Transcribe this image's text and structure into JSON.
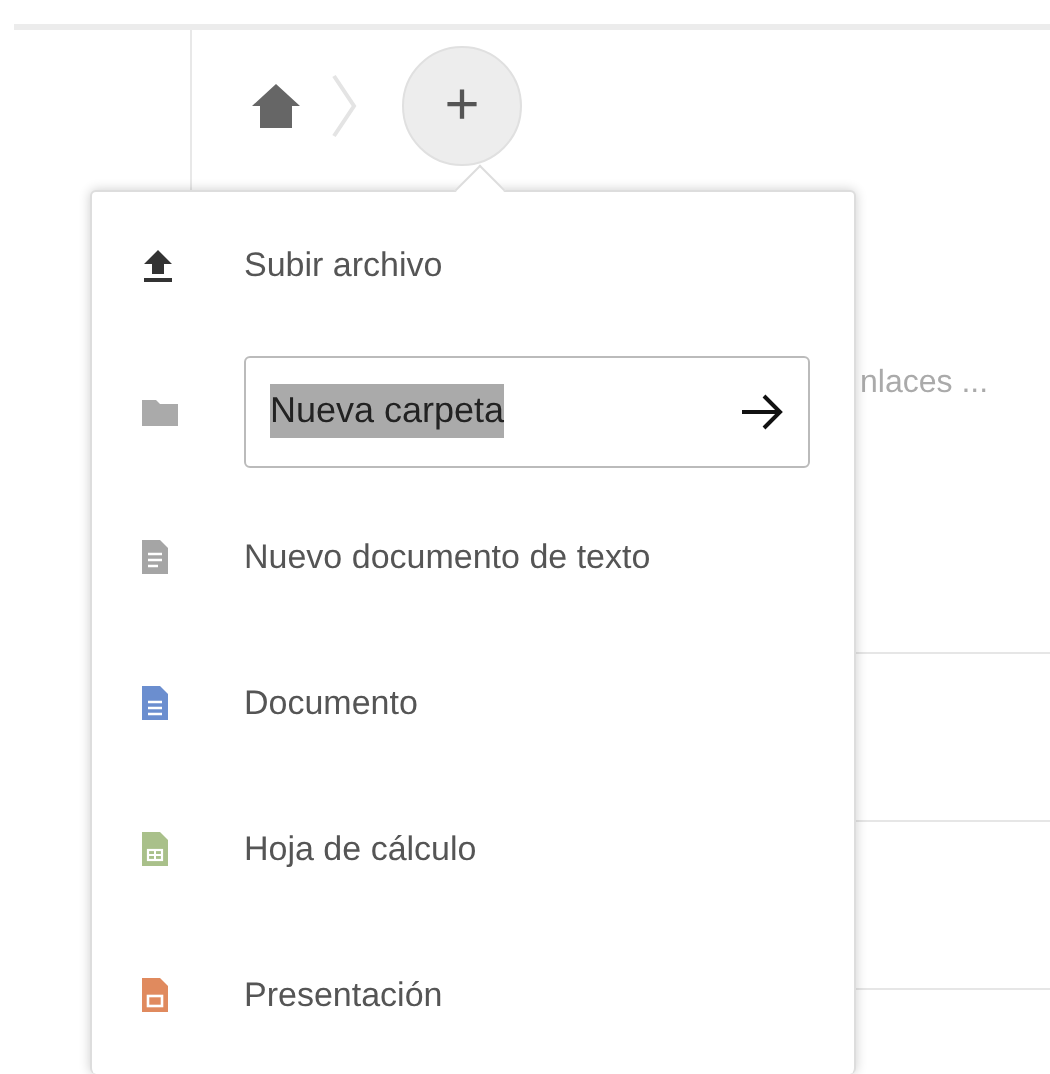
{
  "breadcrumb": {
    "add_button": "+"
  },
  "background_rows": [
    {
      "text": "nlaces ..."
    }
  ],
  "menu": {
    "items": [
      {
        "kind": "upload",
        "label": "Subir archivo"
      },
      {
        "kind": "folder",
        "value": "Nueva carpeta",
        "text_selected": true
      },
      {
        "kind": "text",
        "label": "Nuevo documento de texto"
      },
      {
        "kind": "document",
        "label": "Documento"
      },
      {
        "kind": "spreadsheet",
        "label": "Hoja de cálculo"
      },
      {
        "kind": "presentation",
        "label": "Presentación"
      }
    ]
  }
}
